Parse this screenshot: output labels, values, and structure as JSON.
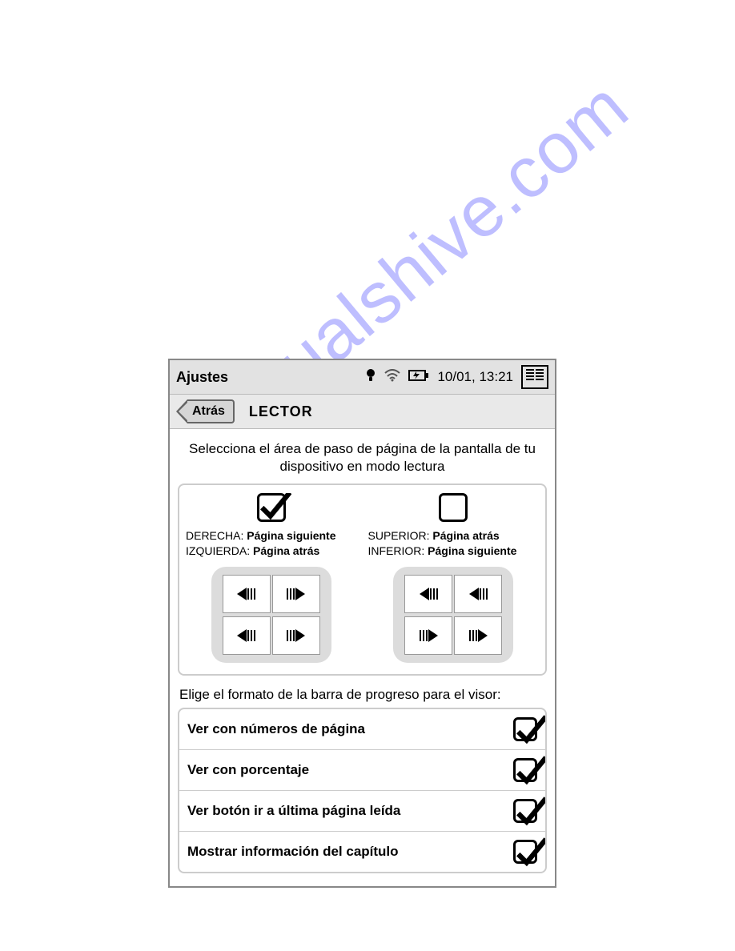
{
  "watermark": "manualshive.com",
  "statusbar": {
    "title": "Ajustes",
    "datetime": "10/01, 13:21"
  },
  "navbar": {
    "back": "Atrás",
    "section": "LECTOR"
  },
  "instruction": "Selecciona el área de paso de página de la pantalla de tu dispositivo en modo lectura",
  "options": {
    "left": {
      "checked": true,
      "line1_label": "DERECHA:",
      "line1_value": "Página siguiente",
      "line2_label": "IZQUIERDA:",
      "line2_value": "Página atrás"
    },
    "right": {
      "checked": false,
      "line1_label": "SUPERIOR:",
      "line1_value": "Página atrás",
      "line2_label": "INFERIOR:",
      "line2_value": "Página siguiente"
    }
  },
  "progress_instruction": "Elige el formato de la barra de progreso para el visor:",
  "progress_items": [
    {
      "label": "Ver con números de página",
      "checked": true
    },
    {
      "label": "Ver con porcentaje",
      "checked": true
    },
    {
      "label": "Ver botón ir a última página leída",
      "checked": true
    },
    {
      "label": "Mostrar información del capítulo",
      "checked": true
    }
  ]
}
